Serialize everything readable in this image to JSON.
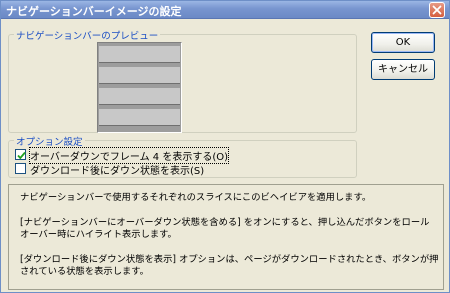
{
  "window": {
    "title": "ナビゲーションバーイメージの設定"
  },
  "preview_group": {
    "label": "ナビゲーションバーのプレビュー",
    "slice_count": 4
  },
  "buttons": {
    "ok_label": "OK",
    "cancel_label": "キャンセル"
  },
  "options_group": {
    "label": "オプション設定",
    "items": [
      {
        "label": "オーバーダウンでフレーム 4 を表示する(O)",
        "checked": true
      },
      {
        "label": "ダウンロード後にダウン状態を表示(S)",
        "checked": false
      }
    ]
  },
  "description": {
    "para1": "ナビゲーションバーで使用するそれぞれのスライスにこのビヘイビアを適用します。",
    "para2_line1": "[ナビゲーションバーにオーバーダウン状態を含める] をオンにすると、押し込んだボタンをロール",
    "para2_line2": "オーバー時にハイライト表示します。",
    "para3_line1": "[ダウンロード後にダウン状態を表示] オプションは、ページがダウンロードされたとき、ボタンが押",
    "para3_line2": "されている状態を表示します。"
  }
}
